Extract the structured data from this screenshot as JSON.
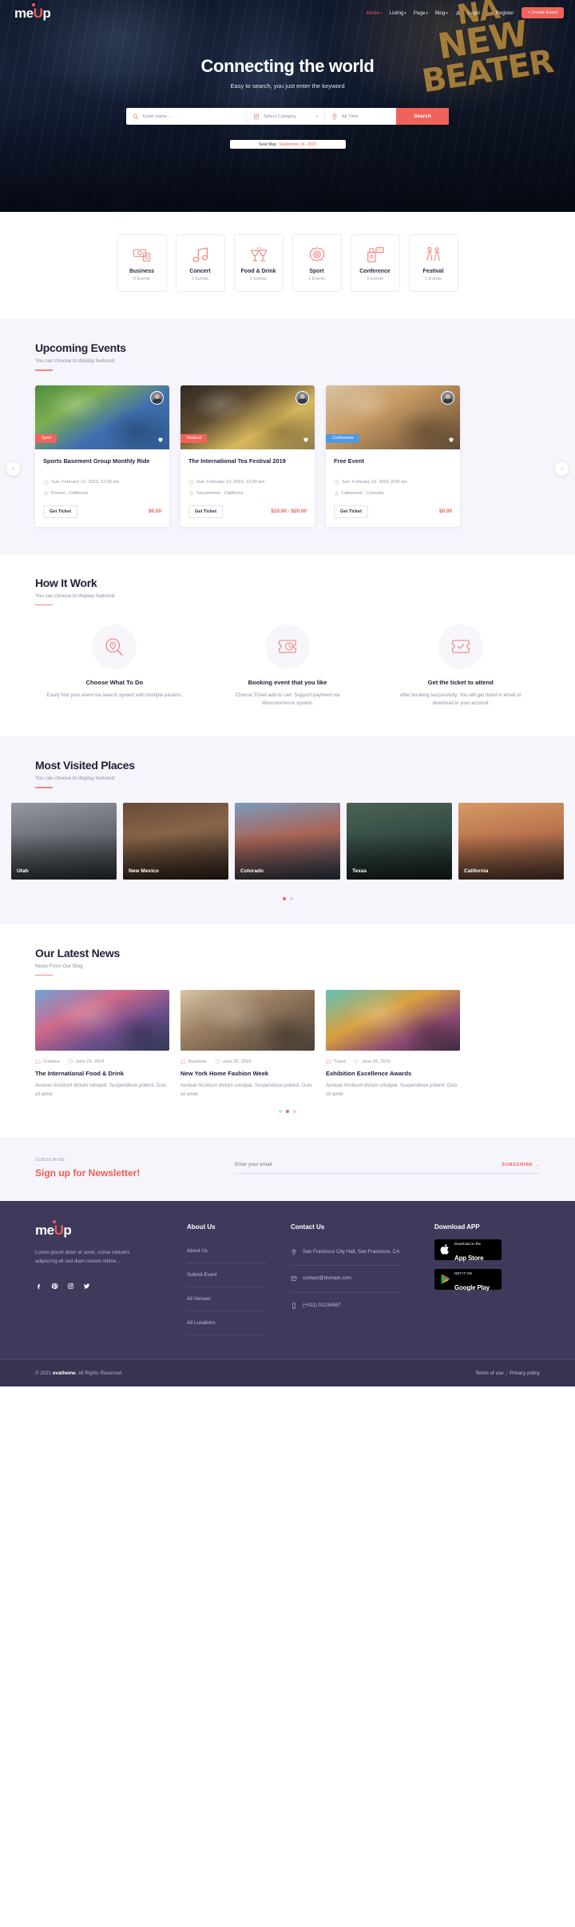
{
  "brand": {
    "name_a": "me",
    "name_u": "U",
    "name_b": "p"
  },
  "nav": {
    "items": [
      {
        "label": "Home",
        "caret": "▾",
        "active": true
      },
      {
        "label": "Listing",
        "caret": "▾",
        "active": false
      },
      {
        "label": "Page",
        "caret": "▾",
        "active": false
      },
      {
        "label": "Blog",
        "caret": "▾",
        "active": false
      }
    ],
    "login": "Login",
    "separator": "|",
    "register": "Register",
    "create_event": "+ Create Event"
  },
  "hero": {
    "title": "Connecting the world",
    "subtitle": "Easy to search, you just enter the keyword",
    "graffiti": {
      "l1": "NA",
      "l2": "NEW",
      "l3": "BEATER"
    },
    "search": {
      "name_placeholder": "Enter name ...",
      "category_placeholder": "Select Category",
      "category_caret": "▾",
      "time_placeholder": "All Time",
      "button": "Search"
    },
    "seatmap": {
      "label": "Seat Map",
      "date": "September 14, 2023"
    }
  },
  "categories": [
    {
      "name": "Business",
      "count": "0  Events",
      "icon": "money-icon"
    },
    {
      "name": "Concert",
      "count": "1  Events",
      "icon": "music-note-icon"
    },
    {
      "name": "Food & Drink",
      "count": "1  Events",
      "icon": "cheers-glasses-icon"
    },
    {
      "name": "Sport",
      "count": "1  Events",
      "icon": "medal-star-icon"
    },
    {
      "name": "Conference",
      "count": "3  Events",
      "icon": "podium-icon"
    },
    {
      "name": "Festival",
      "count": "1  Events",
      "icon": "dancers-icon"
    }
  ],
  "upcoming": {
    "title": "Upcoming Events",
    "subtitle": "You can choose to display featured",
    "prev": "‹",
    "next": "›",
    "cards": [
      {
        "badge": "Sport",
        "badge_kind": "sport",
        "title": "Sports Basement Group Monthly Ride",
        "date": "Sun, February 12, 2023, 12:00 am",
        "place": "Fresno , California",
        "button": "Get Ticket",
        "price": "$0.00"
      },
      {
        "badge": "Festival",
        "badge_kind": "festival",
        "title": "The International Tea Festival 2019",
        "date": "Sun, February 12, 2023, 12:00 am",
        "place": "Sacramento , California",
        "button": "Get Ticket",
        "price": "$10.00 - $20.00"
      },
      {
        "badge": "Conference",
        "badge_kind": "conference",
        "title": "Free Event",
        "date": "Sun, February 12, 2023, 8:00 am",
        "place": "Lakewood , Colorado",
        "button": "Get Ticket",
        "price": "$0.00"
      }
    ]
  },
  "how": {
    "title": "How It Work",
    "subtitle": "You can choose to display featured",
    "steps": [
      {
        "icon": "search-location-icon",
        "title": "Choose What To Do",
        "text": "Easily find your event via search system with multiple params."
      },
      {
        "icon": "ticket-clock-icon",
        "title": "Booking event that you like",
        "text": "Choose Ticket add to cart. Support payment via Woocommerce system."
      },
      {
        "icon": "ticket-check-icon",
        "title": "Get the ticket to attend",
        "text": "After booking successfully, You will get ticket in email or download in your account"
      }
    ]
  },
  "places": {
    "title": "Most Visited Places",
    "subtitle": "You can choose to display featured",
    "items": [
      {
        "name": "Utah"
      },
      {
        "name": "New Mexico"
      },
      {
        "name": "Colorado"
      },
      {
        "name": "Texas"
      },
      {
        "name": "California"
      }
    ],
    "dots": [
      "on",
      "off"
    ]
  },
  "news": {
    "title": "Our Latest News",
    "subtitle": "News From Our Blog",
    "items": [
      {
        "category": "Creative",
        "date": "June 25, 2019",
        "title": "The International Food & Drink",
        "text": "Aenean tincidunt dictum volutpat. Suspendisse potenti. Duis sit amet"
      },
      {
        "category": "Business",
        "date": "June 25, 2019",
        "title": "New York Home Fashion Week",
        "text": "Aenean tincidunt dictum volutpat. Suspendisse potenti. Duis sit amet"
      },
      {
        "category": "Travel",
        "date": "June 25, 2019",
        "title": "Exhibition Excellence Awards",
        "text": "Aenean tincidunt dictum volutpat. Suspendisse potenti. Duis sit amet"
      }
    ],
    "dots": [
      "off",
      "on",
      "off"
    ]
  },
  "newsletter": {
    "kicker": "SUBSCRIBE",
    "heading": "Sign up for Newsletter!",
    "placeholder": "Enter your email",
    "button": "SUBSCRIBE  →"
  },
  "footer": {
    "description": "Lorem ipsum dolor sit amet, conse ctetuers adipiscing eli sed diam nonum nibhie...",
    "social": [
      "facebook-icon",
      "pinterest-icon",
      "instagram-icon",
      "twitter-icon"
    ],
    "about": {
      "heading": "About Us",
      "links": [
        "About Us",
        "Submit Event",
        "All Venues",
        "All Locations"
      ]
    },
    "contact": {
      "heading": "Contact Us",
      "address": "San Francisco City Hall, San Francisco, CA",
      "email": "contact@domain.com",
      "phone": "(+011) 01234567"
    },
    "download": {
      "heading": "Download APP",
      "apple": {
        "small": "Download on the",
        "big": "App Store"
      },
      "google": {
        "small": "GET IT ON",
        "big": "Google Play"
      }
    },
    "copyright_pre": "© 2021 ",
    "copyright_brand": "ovatheme",
    "copyright_post": ". All Rights Reserved.",
    "terms": "Terms of use",
    "legal_sep": "|",
    "privacy": "Privacy policy"
  },
  "colors": {
    "accent": "#ef5a52",
    "footer_bg": "#3d3a5c",
    "lavender": "#f6f5fc"
  }
}
